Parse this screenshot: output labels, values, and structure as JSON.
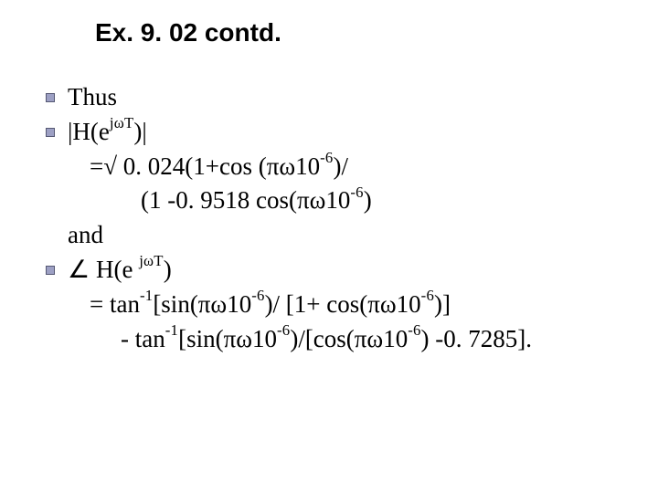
{
  "title": "Ex. 9. 02 contd.",
  "lines": {
    "l1": "Thus",
    "l2a": "|H(e",
    "l2exp": "jωT",
    "l2b": ")|",
    "l3a": "=√ 0. 024(1+cos (πω10",
    "l3exp": "-6",
    "l3b": ")/",
    "l4a": "(1 -0. 9518 cos(πω10",
    "l4exp": "-6",
    "l4b": ")",
    "l5": "and",
    "l6a": "∠ H(e ",
    "l6exp": "jωT",
    "l6b": ")",
    "l7a": "=  tan",
    "l7exp1": "-1",
    "l7b": "[sin(πω10",
    "l7exp2": "-6",
    "l7c": ")/ [1+ cos(πω10",
    "l7exp3": "-6",
    "l7d": ")]",
    "l8a": "- tan",
    "l8exp1": "-1",
    "l8b": "[sin(πω10",
    "l8exp2": "-6",
    "l8c": ")/[cos(πω10",
    "l8exp3": "-6",
    "l8d": ") -0. 7285]."
  }
}
